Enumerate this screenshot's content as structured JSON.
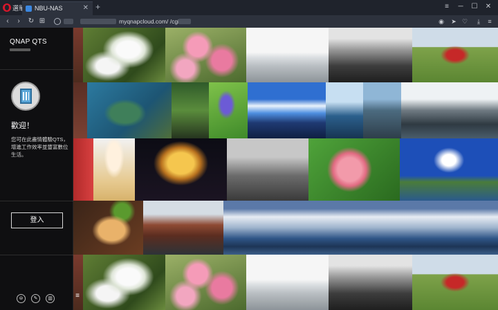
{
  "browser": {
    "menu_label": "選單",
    "tab_title": "NBU-NAS",
    "tab_close": "✕",
    "new_tab": "+",
    "url_text": "myqnapcloud.com/          /cgi-bin/",
    "window_controls": [
      "≡",
      "─",
      "☐",
      "✕"
    ],
    "nav_icons": [
      "‹",
      "›",
      "↻",
      "⊞"
    ],
    "address_icons": [
      "📷",
      "➤",
      "♡",
      "⤓",
      "≡"
    ]
  },
  "panel": {
    "brand": "QNAP QTS",
    "welcome": "歡迎！",
    "intro": "您可在此盡情體驗QTS，增進工作效率並豐富數位生活。",
    "login_label": "登入",
    "footer_icons": [
      "⊜",
      "✎",
      "▥"
    ],
    "menu_icon": "≡"
  }
}
